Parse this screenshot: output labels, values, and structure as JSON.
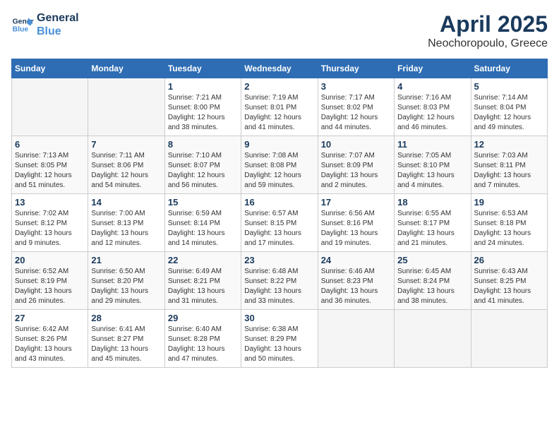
{
  "logo": {
    "line1": "General",
    "line2": "Blue"
  },
  "title": "April 2025",
  "subtitle": "Neochoropoulo, Greece",
  "days_of_week": [
    "Sunday",
    "Monday",
    "Tuesday",
    "Wednesday",
    "Thursday",
    "Friday",
    "Saturday"
  ],
  "weeks": [
    [
      {
        "day": "",
        "info": ""
      },
      {
        "day": "",
        "info": ""
      },
      {
        "day": "1",
        "info": "Sunrise: 7:21 AM\nSunset: 8:00 PM\nDaylight: 12 hours and 38 minutes."
      },
      {
        "day": "2",
        "info": "Sunrise: 7:19 AM\nSunset: 8:01 PM\nDaylight: 12 hours and 41 minutes."
      },
      {
        "day": "3",
        "info": "Sunrise: 7:17 AM\nSunset: 8:02 PM\nDaylight: 12 hours and 44 minutes."
      },
      {
        "day": "4",
        "info": "Sunrise: 7:16 AM\nSunset: 8:03 PM\nDaylight: 12 hours and 46 minutes."
      },
      {
        "day": "5",
        "info": "Sunrise: 7:14 AM\nSunset: 8:04 PM\nDaylight: 12 hours and 49 minutes."
      }
    ],
    [
      {
        "day": "6",
        "info": "Sunrise: 7:13 AM\nSunset: 8:05 PM\nDaylight: 12 hours and 51 minutes."
      },
      {
        "day": "7",
        "info": "Sunrise: 7:11 AM\nSunset: 8:06 PM\nDaylight: 12 hours and 54 minutes."
      },
      {
        "day": "8",
        "info": "Sunrise: 7:10 AM\nSunset: 8:07 PM\nDaylight: 12 hours and 56 minutes."
      },
      {
        "day": "9",
        "info": "Sunrise: 7:08 AM\nSunset: 8:08 PM\nDaylight: 12 hours and 59 minutes."
      },
      {
        "day": "10",
        "info": "Sunrise: 7:07 AM\nSunset: 8:09 PM\nDaylight: 13 hours and 2 minutes."
      },
      {
        "day": "11",
        "info": "Sunrise: 7:05 AM\nSunset: 8:10 PM\nDaylight: 13 hours and 4 minutes."
      },
      {
        "day": "12",
        "info": "Sunrise: 7:03 AM\nSunset: 8:11 PM\nDaylight: 13 hours and 7 minutes."
      }
    ],
    [
      {
        "day": "13",
        "info": "Sunrise: 7:02 AM\nSunset: 8:12 PM\nDaylight: 13 hours and 9 minutes."
      },
      {
        "day": "14",
        "info": "Sunrise: 7:00 AM\nSunset: 8:13 PM\nDaylight: 13 hours and 12 minutes."
      },
      {
        "day": "15",
        "info": "Sunrise: 6:59 AM\nSunset: 8:14 PM\nDaylight: 13 hours and 14 minutes."
      },
      {
        "day": "16",
        "info": "Sunrise: 6:57 AM\nSunset: 8:15 PM\nDaylight: 13 hours and 17 minutes."
      },
      {
        "day": "17",
        "info": "Sunrise: 6:56 AM\nSunset: 8:16 PM\nDaylight: 13 hours and 19 minutes."
      },
      {
        "day": "18",
        "info": "Sunrise: 6:55 AM\nSunset: 8:17 PM\nDaylight: 13 hours and 21 minutes."
      },
      {
        "day": "19",
        "info": "Sunrise: 6:53 AM\nSunset: 8:18 PM\nDaylight: 13 hours and 24 minutes."
      }
    ],
    [
      {
        "day": "20",
        "info": "Sunrise: 6:52 AM\nSunset: 8:19 PM\nDaylight: 13 hours and 26 minutes."
      },
      {
        "day": "21",
        "info": "Sunrise: 6:50 AM\nSunset: 8:20 PM\nDaylight: 13 hours and 29 minutes."
      },
      {
        "day": "22",
        "info": "Sunrise: 6:49 AM\nSunset: 8:21 PM\nDaylight: 13 hours and 31 minutes."
      },
      {
        "day": "23",
        "info": "Sunrise: 6:48 AM\nSunset: 8:22 PM\nDaylight: 13 hours and 33 minutes."
      },
      {
        "day": "24",
        "info": "Sunrise: 6:46 AM\nSunset: 8:23 PM\nDaylight: 13 hours and 36 minutes."
      },
      {
        "day": "25",
        "info": "Sunrise: 6:45 AM\nSunset: 8:24 PM\nDaylight: 13 hours and 38 minutes."
      },
      {
        "day": "26",
        "info": "Sunrise: 6:43 AM\nSunset: 8:25 PM\nDaylight: 13 hours and 41 minutes."
      }
    ],
    [
      {
        "day": "27",
        "info": "Sunrise: 6:42 AM\nSunset: 8:26 PM\nDaylight: 13 hours and 43 minutes."
      },
      {
        "day": "28",
        "info": "Sunrise: 6:41 AM\nSunset: 8:27 PM\nDaylight: 13 hours and 45 minutes."
      },
      {
        "day": "29",
        "info": "Sunrise: 6:40 AM\nSunset: 8:28 PM\nDaylight: 13 hours and 47 minutes."
      },
      {
        "day": "30",
        "info": "Sunrise: 6:38 AM\nSunset: 8:29 PM\nDaylight: 13 hours and 50 minutes."
      },
      {
        "day": "",
        "info": ""
      },
      {
        "day": "",
        "info": ""
      },
      {
        "day": "",
        "info": ""
      }
    ]
  ]
}
